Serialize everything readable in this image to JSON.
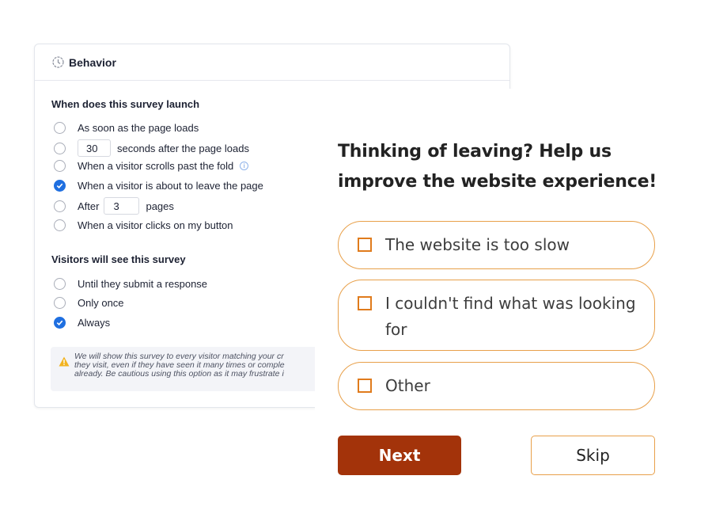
{
  "behavior": {
    "title": "Behavior",
    "launch_title": "When does this survey launch",
    "launch_options": [
      {
        "label": "As soon as the page loads",
        "checked": false
      },
      {
        "value": "30",
        "label": "seconds after the page loads",
        "checked": false
      },
      {
        "label": "When a visitor scrolls past the fold",
        "checked": false
      },
      {
        "label": "When a visitor is about to leave the page",
        "checked": true
      },
      {
        "prefix": "After",
        "value": "3",
        "label": "pages",
        "checked": false
      },
      {
        "label": "When a visitor clicks on my button",
        "checked": false
      }
    ],
    "frequency_title": "Visitors will see this survey",
    "frequency_options": [
      {
        "label": "Until they submit a response",
        "checked": false
      },
      {
        "label": "Only once",
        "checked": false
      },
      {
        "label": "Always",
        "checked": true
      }
    ],
    "warning_lines": [
      "We will show this survey to every visitor matching your cr",
      "they visit, even if they have seen it many times or comple",
      "already. Be cautious using this option as it may frustrate i"
    ]
  },
  "survey": {
    "question_line1": "Thinking of leaving? Help us",
    "question_line2": "improve the website experience!",
    "choices": [
      {
        "line1": "The website is too slow"
      },
      {
        "line1": "I couldn't find what was looking",
        "line2": "for"
      },
      {
        "line1": "Other"
      }
    ],
    "next_label": "Next",
    "skip_label": "Skip"
  },
  "colors": {
    "accent": "#a3330a",
    "choice_border": "#e8a04a",
    "checkbox": "#e07b1c",
    "radio_checked": "#1f6fe0"
  }
}
